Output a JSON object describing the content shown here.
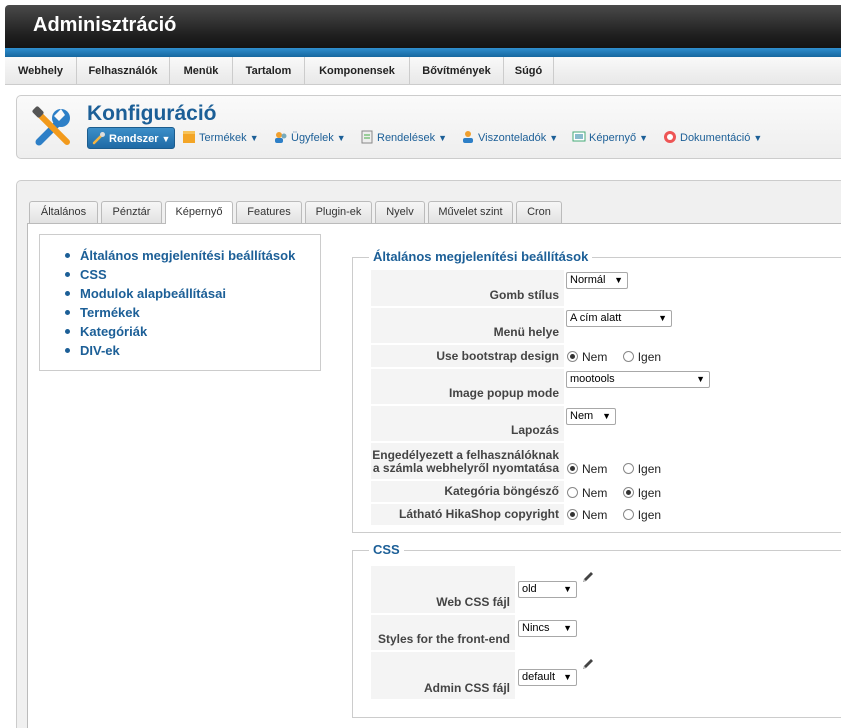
{
  "header": {
    "title": "Adminisztráció"
  },
  "menubar": {
    "items": [
      "Webhely",
      "Felhasználók",
      "Menük",
      "Tartalom",
      "Komponensek",
      "Bővítmények",
      "Súgó"
    ]
  },
  "page": {
    "title": "Konfiguráció"
  },
  "toolbar": {
    "items": [
      {
        "label": "Rendszer",
        "icon": "wrench-icon"
      },
      {
        "label": "Termékek",
        "icon": "box-icon"
      },
      {
        "label": "Ügyfelek",
        "icon": "users-icon"
      },
      {
        "label": "Rendelések",
        "icon": "order-icon"
      },
      {
        "label": "Viszonteladók",
        "icon": "partner-icon"
      },
      {
        "label": "Képernyő",
        "icon": "screen-icon"
      },
      {
        "label": "Dokumentáció",
        "icon": "help-icon"
      }
    ]
  },
  "tabs": [
    "Általános",
    "Pénztár",
    "Képernyő",
    "Features",
    "Plugin-ek",
    "Nyelv",
    "Művelet szint",
    "Cron"
  ],
  "active_tab": "Képernyő",
  "sidenav": {
    "items": [
      "Általános megjelenítési beállítások",
      "CSS",
      "Modulok alapbeállításai",
      "Termékek",
      "Kategóriák",
      "DIV-ek"
    ]
  },
  "general": {
    "legend": "Általános megjelenítési beállítások",
    "button_style": {
      "label": "Gomb stílus",
      "value": "Normál"
    },
    "menu_position": {
      "label": "Menü helye",
      "value": "A cím alatt"
    },
    "bootstrap": {
      "label": "Use bootstrap design",
      "no": "Nem",
      "yes": "Igen",
      "selected": "Nem"
    },
    "image_popup": {
      "label": "Image popup mode",
      "value": "mootools"
    },
    "pagination": {
      "label": "Lapozás",
      "value": "Nem"
    },
    "print_invoice": {
      "label1": "Engedélyezett a felhasználóknak",
      "label2": "a számla webhelyről nyomtatása",
      "no": "Nem",
      "yes": "Igen",
      "selected": "Nem"
    },
    "category_browse": {
      "label": "Kategória böngésző",
      "no": "Nem",
      "yes": "Igen",
      "selected": "Igen"
    },
    "copyright": {
      "label": "Látható HikaShop copyright",
      "no": "Nem",
      "yes": "Igen",
      "selected": "Nem"
    }
  },
  "css": {
    "legend": "CSS",
    "web_css": {
      "label": "Web CSS fájl",
      "value": "old"
    },
    "frontend_styles": {
      "label": "Styles for the front-end",
      "value": "Nincs"
    },
    "admin_css": {
      "label": "Admin CSS fájl",
      "value": "default"
    }
  },
  "colors": {
    "accent": "#1c5f97",
    "header_bar": "#1f7ab8"
  }
}
